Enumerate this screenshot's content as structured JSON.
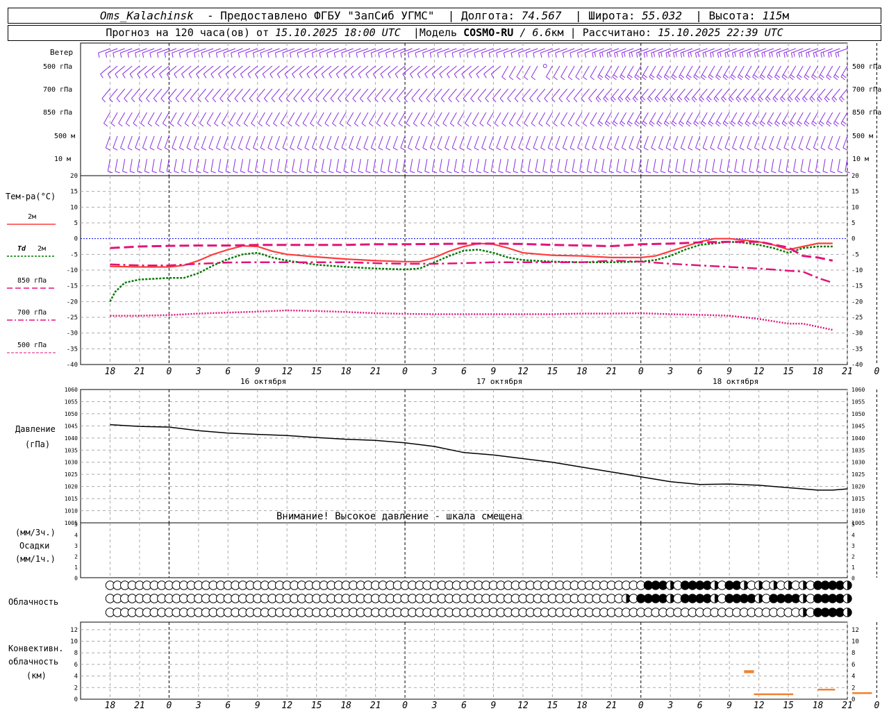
{
  "header": {
    "station": "Oms_Kalachinsk",
    "provided_by": "Предоставлено ФГБУ \"ЗапСиб УГМС\"",
    "lon_label": "Долгота:",
    "lon_value": "74.567",
    "lat_label": "Широта:",
    "lat_value": "55.032",
    "alt_label": "Высота:",
    "alt_value": "115",
    "alt_unit": "м",
    "forecast_prefix": "Прогноз на 120 часа(ов) от",
    "forecast_start": "15.10.2025 18:00 UTC",
    "model_label": "Модель",
    "model_name": "COSMO-RU",
    "model_res": "/ 6.6",
    "model_res_unit": "км",
    "computed_label": "Рассчитано:",
    "computed_at": "15.10.2025 22:39 UTC"
  },
  "labels": {
    "wind": "Ветер",
    "wind_levels": [
      "500 гПа",
      "700 гПа",
      "850 гПа",
      "500 м",
      "10 м"
    ],
    "temp_title": "Тем-ра(°C)",
    "temp_2m": "2м",
    "td": "Td",
    "td_2m": "2м",
    "t850": "850 гПа",
    "t700": "700 гПа",
    "t500": "500 гПа",
    "pressure_title": "Давление",
    "pressure_unit": "(гПа)",
    "pressure_warning": "Внимание! Высокое давление - шкала смещена",
    "precip_3h": "(мм/3ч.)",
    "precip_title": "Осадки",
    "precip_1h": "(мм/1ч.)",
    "cloud_title": "Облачность",
    "conv_line1": "Конвективн.",
    "conv_line2": "облачность",
    "conv_line3": "(км)",
    "day_labels": [
      "16 октября",
      "17 октября",
      "18 октября"
    ]
  },
  "colors": {
    "wind": "#8a2be2",
    "t2m": "#ff3c3c",
    "td": "#007a00",
    "tlevels": "#e0147a",
    "pressure": "#000000",
    "conv": "#f08030",
    "zero_line": "#0000ff"
  },
  "chart_data": {
    "type": "line",
    "x_hours": [
      -6,
      0,
      6,
      12,
      18,
      24,
      30,
      36,
      42,
      48,
      54,
      60,
      66,
      72,
      78,
      84,
      90,
      96,
      102,
      108,
      114,
      120,
      126,
      132,
      138,
      144,
      150,
      156
    ],
    "x_tick_labels": [
      "18",
      "21",
      "0",
      "3",
      "6",
      "9",
      "12",
      "15",
      "18",
      "21",
      "0",
      "3",
      "6",
      "9",
      "12",
      "15",
      "18",
      "21",
      "0",
      "3",
      "6",
      "9",
      "12",
      "15",
      "18",
      "21",
      "0"
    ],
    "temperature": {
      "ylim": [
        -40,
        20
      ],
      "ticks": [
        20,
        15,
        10,
        5,
        0,
        -5,
        -10,
        -15,
        -20,
        -25,
        -30,
        -35,
        -40
      ],
      "series": [
        {
          "name": "2м",
          "style": "solid",
          "points": [
            [
              0,
              -8.8
            ],
            [
              6,
              -9
            ],
            [
              12,
              -9
            ],
            [
              15,
              -8.5
            ],
            [
              18,
              -7
            ],
            [
              21,
              -5
            ],
            [
              24,
              -3.5
            ],
            [
              27,
              -2.3
            ],
            [
              30,
              -2.5
            ],
            [
              33,
              -4
            ],
            [
              36,
              -5
            ],
            [
              42,
              -5.8
            ],
            [
              48,
              -6.5
            ],
            [
              54,
              -7
            ],
            [
              60,
              -7.3
            ],
            [
              63,
              -7.3
            ],
            [
              66,
              -6
            ],
            [
              69,
              -4
            ],
            [
              72,
              -2.5
            ],
            [
              75,
              -1.5
            ],
            [
              78,
              -1.8
            ],
            [
              81,
              -3
            ],
            [
              84,
              -4.5
            ],
            [
              90,
              -5.3
            ],
            [
              96,
              -5.5
            ],
            [
              102,
              -6
            ],
            [
              108,
              -6
            ],
            [
              111,
              -5.5
            ],
            [
              114,
              -4
            ],
            [
              117,
              -2.5
            ],
            [
              120,
              -1
            ],
            [
              123,
              0
            ],
            [
              126,
              0
            ],
            [
              129,
              -0.5
            ],
            [
              132,
              -1
            ],
            [
              135,
              -2
            ],
            [
              138,
              -3.5
            ],
            [
              141,
              -2.5
            ],
            [
              144,
              -1.5
            ],
            [
              147,
              -1.5
            ]
          ]
        },
        {
          "name": "Td",
          "style": "dotted",
          "points": [
            [
              0,
              -20
            ],
            [
              1,
              -17
            ],
            [
              3,
              -14
            ],
            [
              6,
              -13
            ],
            [
              12,
              -12.5
            ],
            [
              15,
              -12.5
            ],
            [
              18,
              -11
            ],
            [
              21,
              -8.5
            ],
            [
              24,
              -6.5
            ],
            [
              27,
              -5
            ],
            [
              30,
              -4.5
            ],
            [
              33,
              -6
            ],
            [
              36,
              -7
            ],
            [
              42,
              -8.3
            ],
            [
              48,
              -9
            ],
            [
              54,
              -9.5
            ],
            [
              60,
              -9.8
            ],
            [
              63,
              -9.5
            ],
            [
              66,
              -7.5
            ],
            [
              69,
              -5.5
            ],
            [
              72,
              -3.8
            ],
            [
              75,
              -3.5
            ],
            [
              78,
              -4.5
            ],
            [
              81,
              -6
            ],
            [
              84,
              -6.8
            ],
            [
              90,
              -7.3
            ],
            [
              96,
              -7.5
            ],
            [
              102,
              -7.5
            ],
            [
              108,
              -7.3
            ],
            [
              111,
              -6.8
            ],
            [
              114,
              -5.5
            ],
            [
              117,
              -3.5
            ],
            [
              120,
              -2
            ],
            [
              123,
              -1.5
            ],
            [
              126,
              -1
            ],
            [
              129,
              -1.3
            ],
            [
              132,
              -2
            ],
            [
              135,
              -3
            ],
            [
              138,
              -4.5
            ],
            [
              141,
              -3
            ],
            [
              144,
              -2.5
            ],
            [
              147,
              -2.5
            ]
          ]
        },
        {
          "name": "850 гПа",
          "style": "dashed",
          "points": [
            [
              0,
              -3
            ],
            [
              6,
              -2.5
            ],
            [
              12,
              -2.3
            ],
            [
              18,
              -2.2
            ],
            [
              24,
              -2.2
            ],
            [
              30,
              -2
            ],
            [
              36,
              -2
            ],
            [
              42,
              -2
            ],
            [
              48,
              -2
            ],
            [
              54,
              -1.8
            ],
            [
              60,
              -1.8
            ],
            [
              66,
              -1.7
            ],
            [
              72,
              -1.6
            ],
            [
              78,
              -1.6
            ],
            [
              84,
              -1.7
            ],
            [
              90,
              -2
            ],
            [
              96,
              -2.2
            ],
            [
              102,
              -2.4
            ],
            [
              108,
              -1.8
            ],
            [
              114,
              -1.6
            ],
            [
              120,
              -1.2
            ],
            [
              126,
              -1
            ],
            [
              132,
              -1
            ],
            [
              138,
              -2.8
            ],
            [
              141,
              -5.5
            ],
            [
              144,
              -6
            ],
            [
              147,
              -7
            ]
          ]
        },
        {
          "name": "700 гПа",
          "style": "dashdot",
          "points": [
            [
              0,
              -8.2
            ],
            [
              6,
              -8.5
            ],
            [
              12,
              -8.5
            ],
            [
              18,
              -8
            ],
            [
              24,
              -7.6
            ],
            [
              30,
              -7.5
            ],
            [
              36,
              -7.5
            ],
            [
              42,
              -7.5
            ],
            [
              48,
              -7.5
            ],
            [
              54,
              -7.8
            ],
            [
              60,
              -8
            ],
            [
              66,
              -8
            ],
            [
              72,
              -7.8
            ],
            [
              78,
              -7.5
            ],
            [
              84,
              -7.5
            ],
            [
              90,
              -7.5
            ],
            [
              96,
              -7.5
            ],
            [
              102,
              -7
            ],
            [
              108,
              -7.3
            ],
            [
              114,
              -8
            ],
            [
              120,
              -8.5
            ],
            [
              126,
              -9
            ],
            [
              132,
              -9.5
            ],
            [
              138,
              -10.2
            ],
            [
              141,
              -10.5
            ],
            [
              144,
              -12.5
            ],
            [
              147,
              -14
            ]
          ]
        },
        {
          "name": "500 гПа",
          "style": "dotted",
          "points": [
            [
              0,
              -24.5
            ],
            [
              6,
              -24.5
            ],
            [
              12,
              -24.3
            ],
            [
              18,
              -23.8
            ],
            [
              24,
              -23.5
            ],
            [
              30,
              -23.2
            ],
            [
              36,
              -22.8
            ],
            [
              42,
              -23
            ],
            [
              48,
              -23.3
            ],
            [
              54,
              -23.7
            ],
            [
              60,
              -23.9
            ],
            [
              66,
              -24
            ],
            [
              72,
              -24
            ],
            [
              78,
              -24
            ],
            [
              84,
              -24
            ],
            [
              90,
              -24
            ],
            [
              96,
              -23.8
            ],
            [
              102,
              -23.8
            ],
            [
              108,
              -23.7
            ],
            [
              114,
              -24
            ],
            [
              120,
              -24.2
            ],
            [
              126,
              -24.5
            ],
            [
              132,
              -25.5
            ],
            [
              138,
              -27
            ],
            [
              141,
              -27
            ],
            [
              144,
              -28
            ],
            [
              147,
              -29
            ]
          ]
        }
      ]
    },
    "pressure": {
      "ylim": [
        1005,
        1060
      ],
      "ticks": [
        1060,
        1055,
        1050,
        1045,
        1040,
        1035,
        1030,
        1025,
        1020,
        1015,
        1010,
        1005
      ],
      "points": [
        [
          0,
          1045.5
        ],
        [
          6,
          1044.8
        ],
        [
          12,
          1044.5
        ],
        [
          18,
          1043
        ],
        [
          24,
          1042
        ],
        [
          30,
          1041.5
        ],
        [
          36,
          1041
        ],
        [
          42,
          1040.2
        ],
        [
          48,
          1039.5
        ],
        [
          54,
          1039
        ],
        [
          60,
          1038
        ],
        [
          66,
          1036.5
        ],
        [
          72,
          1034
        ],
        [
          78,
          1033
        ],
        [
          84,
          1031.5
        ],
        [
          90,
          1030
        ],
        [
          96,
          1028
        ],
        [
          102,
          1026
        ],
        [
          108,
          1024
        ],
        [
          114,
          1022
        ],
        [
          120,
          1020.8
        ],
        [
          126,
          1021
        ],
        [
          132,
          1020.5
        ],
        [
          138,
          1019.5
        ],
        [
          144,
          1018.5
        ],
        [
          147,
          1018.5
        ],
        [
          150,
          1019
        ]
      ]
    },
    "precipitation": {
      "ylim": [
        0,
        5
      ],
      "ticks": [
        5,
        4,
        3,
        2,
        1,
        0
      ],
      "values": []
    },
    "convective": {
      "ylim": [
        0,
        13
      ],
      "ticks": [
        12,
        10,
        8,
        6,
        4,
        2,
        0
      ],
      "segments": [
        [
          129,
          131,
          4.5,
          5.0
        ],
        [
          131,
          139,
          0.7,
          1.0
        ],
        [
          144,
          147.5,
          1.5,
          1.8
        ],
        [
          151,
          155,
          0.9,
          1.2
        ]
      ]
    },
    "cloud_rows": {
      "high": {
        "dark_from_hour": 108.5,
        "rows_hint": "partial"
      },
      "middle": {
        "dark_from_hour": 105,
        "rows_hint": "partial"
      },
      "low": {
        "dark_from_hour": 141,
        "rows_hint": "partial"
      }
    }
  }
}
